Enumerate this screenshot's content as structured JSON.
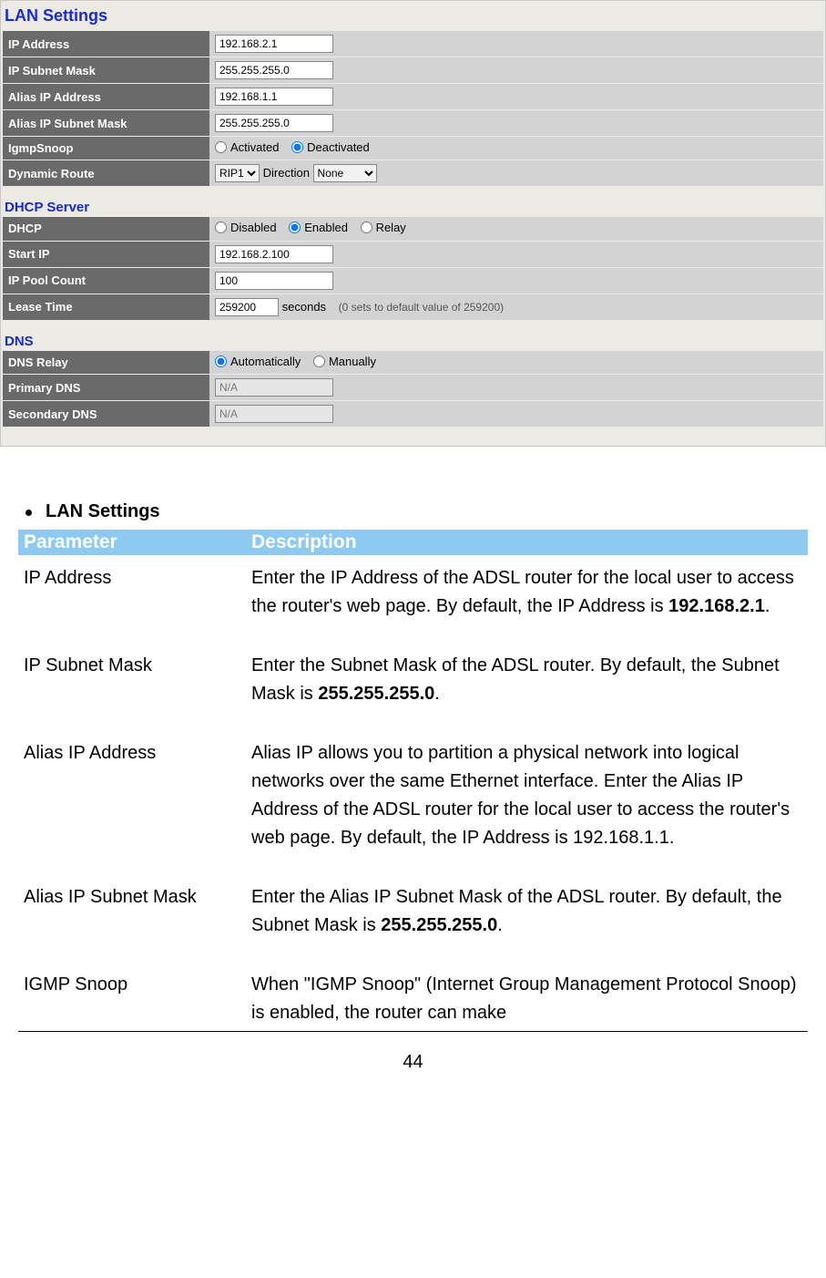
{
  "panel": {
    "title": "LAN Settings",
    "lan": {
      "rows": {
        "ip_address": {
          "label": "IP Address",
          "value": "192.168.2.1"
        },
        "ip_subnet_mask": {
          "label": "IP Subnet Mask",
          "value": "255.255.255.0"
        },
        "alias_ip_address": {
          "label": "Alias IP Address",
          "value": "192.168.1.1"
        },
        "alias_ip_subnet_mask": {
          "label": "Alias IP Subnet Mask",
          "value": "255.255.255.0"
        },
        "igmp_snoop": {
          "label": "IgmpSnoop",
          "opt_activated": "Activated",
          "opt_deactivated": "Deactivated"
        },
        "dynamic_route": {
          "label": "Dynamic Route",
          "sel1": "RIP1",
          "direction_label": "Direction",
          "sel2": "None"
        }
      }
    },
    "dhcp": {
      "title": "DHCP Server",
      "rows": {
        "dhcp": {
          "label": "DHCP",
          "disabled": "Disabled",
          "enabled": "Enabled",
          "relay": "Relay"
        },
        "start_ip": {
          "label": "Start IP",
          "value": "192.168.2.100"
        },
        "ip_pool_count": {
          "label": "IP Pool Count",
          "value": "100"
        },
        "lease_time": {
          "label": "Lease Time",
          "value": "259200",
          "unit": "seconds",
          "hint": "(0 sets to default value of 259200)"
        }
      }
    },
    "dns": {
      "title": "DNS",
      "rows": {
        "dns_relay": {
          "label": "DNS Relay",
          "auto": "Automatically",
          "manual": "Manually"
        },
        "primary": {
          "label": "Primary DNS",
          "value": "N/A"
        },
        "secondary": {
          "label": "Secondary DNS",
          "value": "N/A"
        }
      }
    }
  },
  "doc": {
    "heading": "LAN Settings",
    "th_param": "Parameter",
    "th_desc": "Description",
    "rows": {
      "r1": {
        "param": "IP Address",
        "desc_a": "Enter the IP Address of the ADSL router for the local user to access the router's web page. By default, the IP Address is ",
        "desc_b_bold": "192.168.2.1",
        "desc_c": "."
      },
      "r2": {
        "param": "IP Subnet Mask",
        "desc_a": "Enter the Subnet Mask of the ADSL router. By default, the Subnet Mask is ",
        "desc_b_bold": "255.255.255.0",
        "desc_c": "."
      },
      "r3": {
        "param": "Alias IP Address",
        "desc": "Alias IP allows you to partition a physical network into logical networks over the same Ethernet interface. Enter the Alias IP Address of the ADSL router for the local user to access the router's web page. By default, the IP Address is 192.168.1.1."
      },
      "r4": {
        "param": "Alias IP Subnet Mask",
        "desc_a": "Enter the Alias IP Subnet Mask of the ADSL router. By default, the Subnet Mask is ",
        "desc_b_bold": "255.255.255.0",
        "desc_c": "."
      },
      "r5": {
        "param": "IGMP Snoop",
        "desc": "When \"IGMP Snoop\" (Internet Group Management Protocol Snoop) is enabled, the router can make"
      }
    }
  },
  "page_number": "44"
}
